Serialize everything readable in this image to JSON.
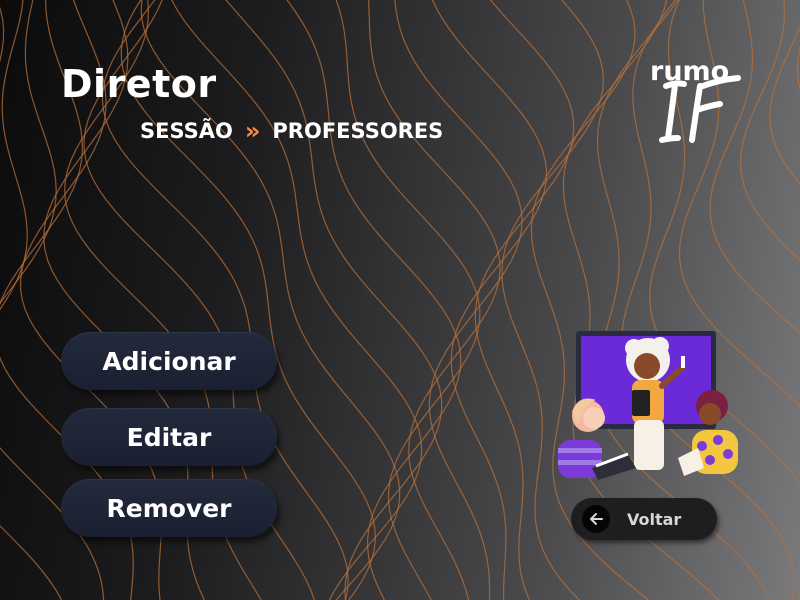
{
  "header": {
    "title": "Diretor",
    "breadcrumb": {
      "parent": "SESSÃO",
      "separator": "»",
      "current": "PROFESSORES"
    }
  },
  "logo": {
    "text_top": "rumo",
    "text_bottom": "IF"
  },
  "menu": {
    "add_label": "Adicionar",
    "edit_label": "Editar",
    "remove_label": "Remover"
  },
  "back_button": {
    "label": "Voltar",
    "icon": "arrow-left-icon"
  },
  "illustration": {
    "name": "teacher-with-students-illustration"
  },
  "colors": {
    "accent": "#ff8a3d",
    "button_bg": "#1f2537",
    "contour_lines": "#b8703a",
    "board": "#6a2ad8"
  }
}
